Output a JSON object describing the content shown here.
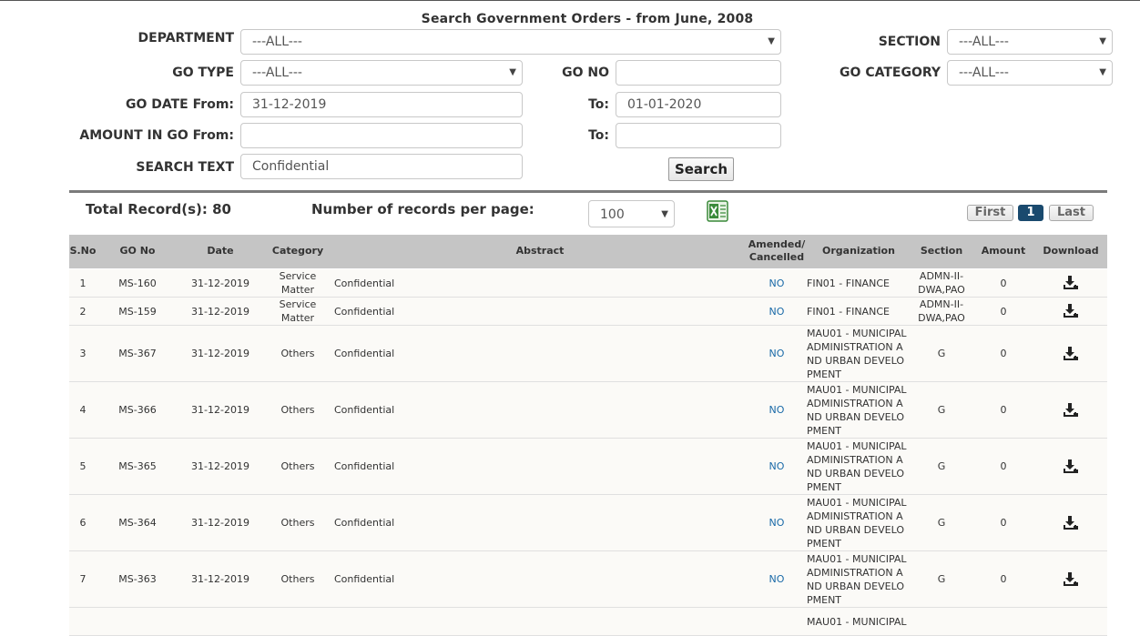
{
  "page_title": "Search Government Orders - from June, 2008",
  "filters": {
    "department_label": "DEPARTMENT",
    "department_value": "---ALL---",
    "section_label": "SECTION",
    "section_value": "---ALL---",
    "go_type_label": "GO TYPE",
    "go_type_value": "---ALL---",
    "go_no_label": "GO NO",
    "go_no_value": "",
    "go_category_label": "GO CATEGORY",
    "go_category_value": "---ALL---",
    "go_date_from_label": "GO DATE From:",
    "go_date_from_value": "31-12-2019",
    "go_date_to_label": "To:",
    "go_date_to_value": "01-01-2020",
    "amount_from_label": "AMOUNT IN GO From:",
    "amount_from_value": "",
    "amount_to_label": "To:",
    "amount_to_value": "",
    "search_text_label": "SEARCH TEXT",
    "search_text_value": "Confidential",
    "search_button": "Search"
  },
  "results_bar": {
    "total_records": "Total Record(s): 80",
    "per_page_label": "Number of records per page:",
    "per_page_value": "100",
    "excel_icon": "excel-export-icon",
    "first": "First",
    "current_page": "1",
    "last": "Last"
  },
  "table": {
    "headers": {
      "sno": "S.No",
      "go_no": "GO No",
      "date": "Date",
      "category": "Category",
      "abstract": "Abstract",
      "amended1": "Amended/",
      "amended2": "Cancelled",
      "organization": "Organization",
      "section": "Section",
      "amount": "Amount",
      "download": "Download"
    },
    "rows": [
      {
        "sno": "1",
        "go_no": "MS-160",
        "date": "31-12-2019",
        "cat1": "Service",
        "cat2": "Matter",
        "abstract": "Confidential",
        "amended": "NO",
        "org": [
          "FIN01 - FINANCE"
        ],
        "sec1": "ADMN-II-",
        "sec2": "DWA,PAO",
        "amount": "0"
      },
      {
        "sno": "2",
        "go_no": "MS-159",
        "date": "31-12-2019",
        "cat1": "Service",
        "cat2": "Matter",
        "abstract": "Confidential",
        "amended": "NO",
        "org": [
          "FIN01 - FINANCE"
        ],
        "sec1": "ADMN-II-",
        "sec2": "DWA,PAO",
        "amount": "0"
      },
      {
        "sno": "3",
        "go_no": "MS-367",
        "date": "31-12-2019",
        "cat1": "Others",
        "cat2": "",
        "abstract": "Confidential",
        "amended": "NO",
        "org": [
          "MAU01 - MUNICIPAL",
          "ADMINISTRATION A",
          "ND URBAN DEVELO",
          "PMENT"
        ],
        "sec1": "G",
        "sec2": "",
        "amount": "0"
      },
      {
        "sno": "4",
        "go_no": "MS-366",
        "date": "31-12-2019",
        "cat1": "Others",
        "cat2": "",
        "abstract": "Confidential",
        "amended": "NO",
        "org": [
          "MAU01 - MUNICIPAL",
          "ADMINISTRATION A",
          "ND URBAN DEVELO",
          "PMENT"
        ],
        "sec1": "G",
        "sec2": "",
        "amount": "0"
      },
      {
        "sno": "5",
        "go_no": "MS-365",
        "date": "31-12-2019",
        "cat1": "Others",
        "cat2": "",
        "abstract": "Confidential",
        "amended": "NO",
        "org": [
          "MAU01 - MUNICIPAL",
          "ADMINISTRATION A",
          "ND URBAN DEVELO",
          "PMENT"
        ],
        "sec1": "G",
        "sec2": "",
        "amount": "0"
      },
      {
        "sno": "6",
        "go_no": "MS-364",
        "date": "31-12-2019",
        "cat1": "Others",
        "cat2": "",
        "abstract": "Confidential",
        "amended": "NO",
        "org": [
          "MAU01 - MUNICIPAL",
          "ADMINISTRATION A",
          "ND URBAN DEVELO",
          "PMENT"
        ],
        "sec1": "G",
        "sec2": "",
        "amount": "0"
      },
      {
        "sno": "7",
        "go_no": "MS-363",
        "date": "31-12-2019",
        "cat1": "Others",
        "cat2": "",
        "abstract": "Confidential",
        "amended": "NO",
        "org": [
          "MAU01 - MUNICIPAL",
          "ADMINISTRATION A",
          "ND URBAN DEVELO",
          "PMENT"
        ],
        "sec1": "G",
        "sec2": "",
        "amount": "0"
      },
      {
        "sno": "",
        "go_no": "",
        "date": "",
        "cat1": "",
        "cat2": "",
        "abstract": "",
        "amended": "",
        "org": [
          "MAU01 - MUNICIPAL"
        ],
        "sec1": "",
        "sec2": "",
        "amount": ""
      }
    ]
  },
  "colors": {
    "header_bg": "#c5c5c5",
    "link": "#1a6aa8",
    "current_page_bg": "#1a4a6e",
    "excel_green": "#3a8a3a"
  }
}
